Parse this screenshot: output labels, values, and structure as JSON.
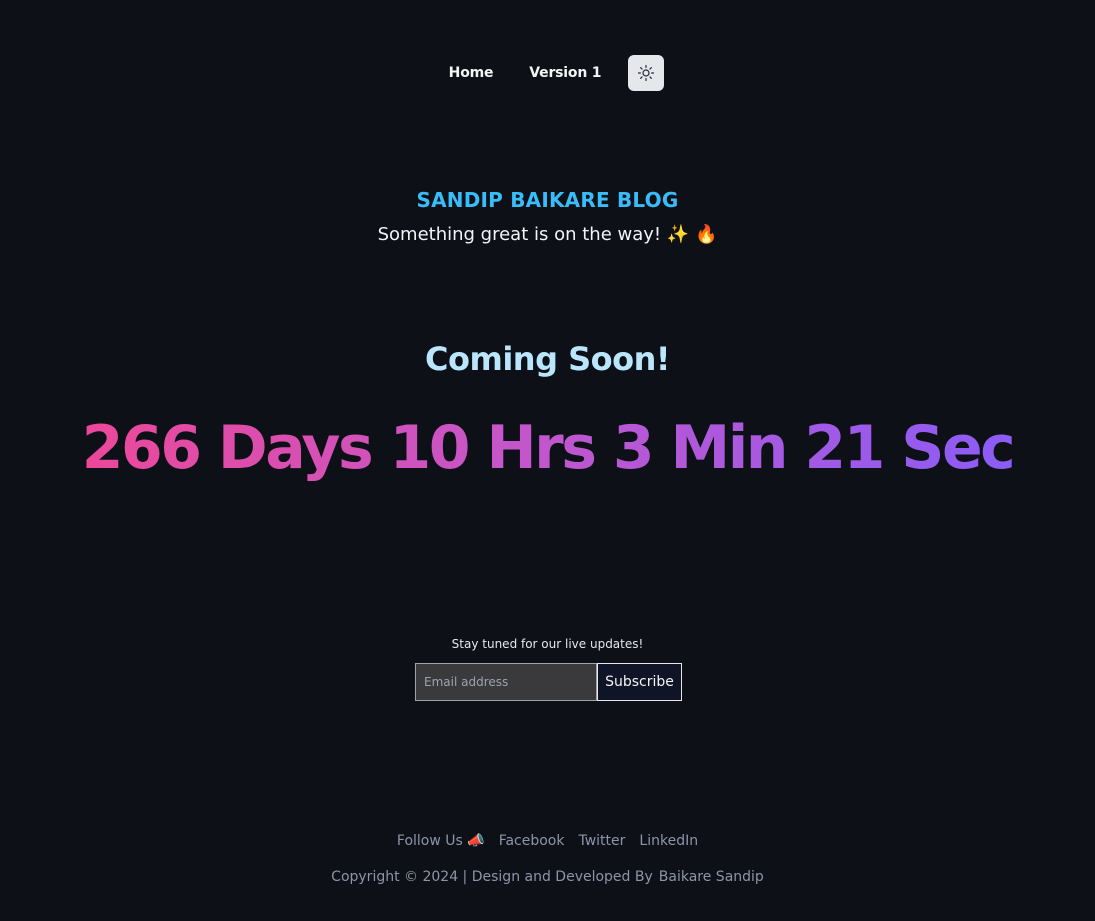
{
  "nav": {
    "home_label": "Home",
    "version_label": "Version 1",
    "theme_toggle_icon": "sun-icon"
  },
  "header": {
    "blog_title": "SANDIP BAIKARE BLOG",
    "tagline": "Something great is on the way! ✨ 🔥"
  },
  "hero": {
    "coming_soon": "Coming Soon!",
    "countdown": "266 Days 10 Hrs 3 Min 21 Sec"
  },
  "subscribe": {
    "prompt": "Stay tuned for our live updates!",
    "email_placeholder": "Email address",
    "button_label": "Subscribe"
  },
  "footer": {
    "follow_label": "Follow Us 📣",
    "links": [
      "Facebook",
      "Twitter",
      "LinkedIn"
    ],
    "copyright": "Copyright © 2024 | Design and Developed By",
    "author_link": "Baikare Sandip"
  },
  "colors": {
    "background": "#0e1018",
    "title_accent": "#38bdf8",
    "coming_soon": "#bae6fd",
    "countdown_gradient_start": "#ec4899",
    "countdown_gradient_end": "#8b5cf6",
    "muted_text": "#8b95a7"
  }
}
